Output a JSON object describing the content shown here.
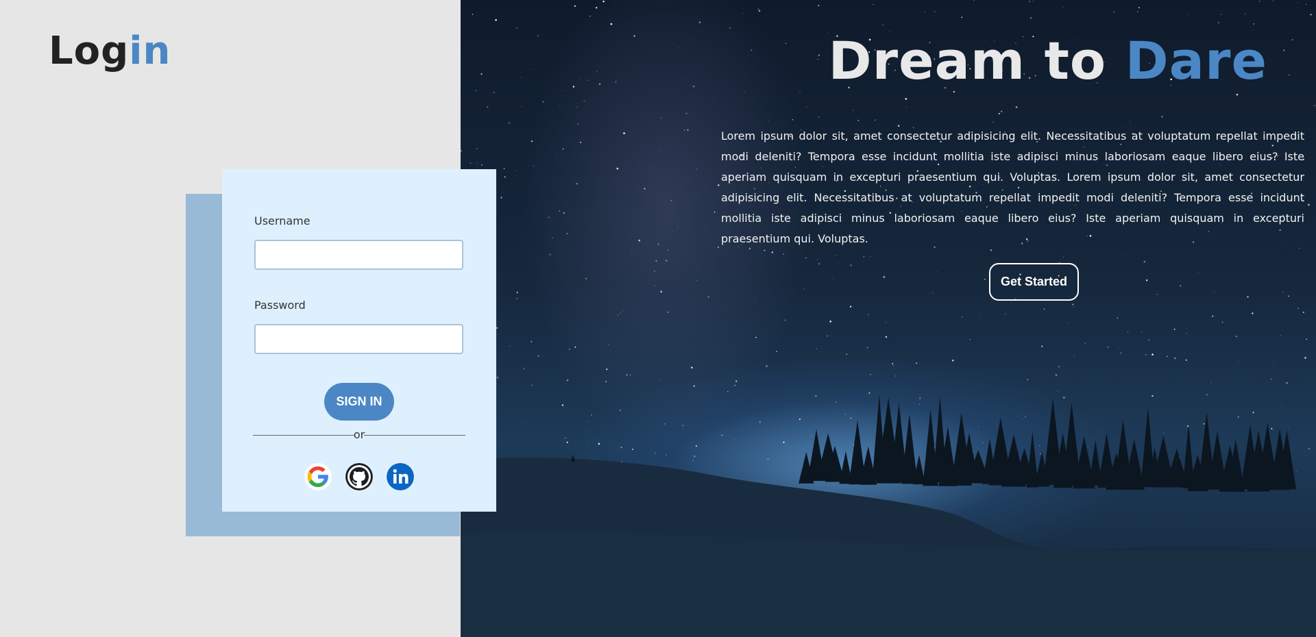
{
  "brand": {
    "logo_main": "Log",
    "logo_accent": "in"
  },
  "hero": {
    "title_main": "Dream to",
    "title_accent": "Dare",
    "body": "Lorem ipsum dolor sit, amet consectetur adipisicing elit. Necessitatibus at voluptatum repellat impedit modi deleniti? Tempora esse incidunt mollitia iste adipisci minus laboriosam eaque libero eius? Iste aperiam quisquam in excepturi praesentium qui. Voluptas. Lorem ipsum dolor sit, amet consectetur adipisicing elit. Necessitatibus at voluptatum repellat impedit modi deleniti? Tempora esse incidunt mollitia iste adipisci minus laboriosam eaque libero eius? Iste aperiam quisquam in excepturi praesentium qui. Voluptas.",
    "cta_label": "Get Started"
  },
  "login_form": {
    "username_label": "Username",
    "username_value": "",
    "password_label": "Password",
    "password_value": "",
    "submit_label": "SIGN IN",
    "divider_text": "or",
    "social_providers": [
      "google-icon",
      "github-icon",
      "linkedin-icon"
    ]
  },
  "colors": {
    "accent": "#4a87c4",
    "card_bg": "#def0fd",
    "card_shadow": "#99bad6",
    "page_bg": "#e6e6e6"
  }
}
